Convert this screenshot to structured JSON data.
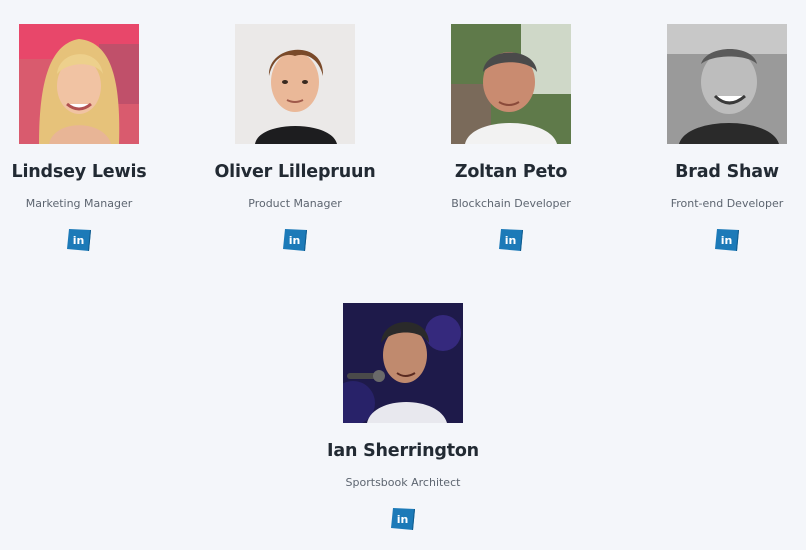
{
  "team": {
    "members": [
      {
        "name": "Lindsey Lewis",
        "role": "Marketing Manager",
        "social_icon": "linkedin-icon"
      },
      {
        "name": "Oliver Lillepruun",
        "role": "Product Manager",
        "social_icon": "linkedin-icon"
      },
      {
        "name": "Zoltan Peto",
        "role": "Blockchain Developer",
        "social_icon": "linkedin-icon"
      },
      {
        "name": "Brad Shaw",
        "role": "Front-end Developer",
        "social_icon": "linkedin-icon"
      },
      {
        "name": "Ian Sherrington",
        "role": "Sportsbook Architect",
        "social_icon": "linkedin-icon"
      }
    ]
  },
  "colors": {
    "background": "#f4f6fa",
    "name_text": "#222a33",
    "role_text": "#5d6570",
    "linkedin_blue": "#1c7ab8"
  }
}
